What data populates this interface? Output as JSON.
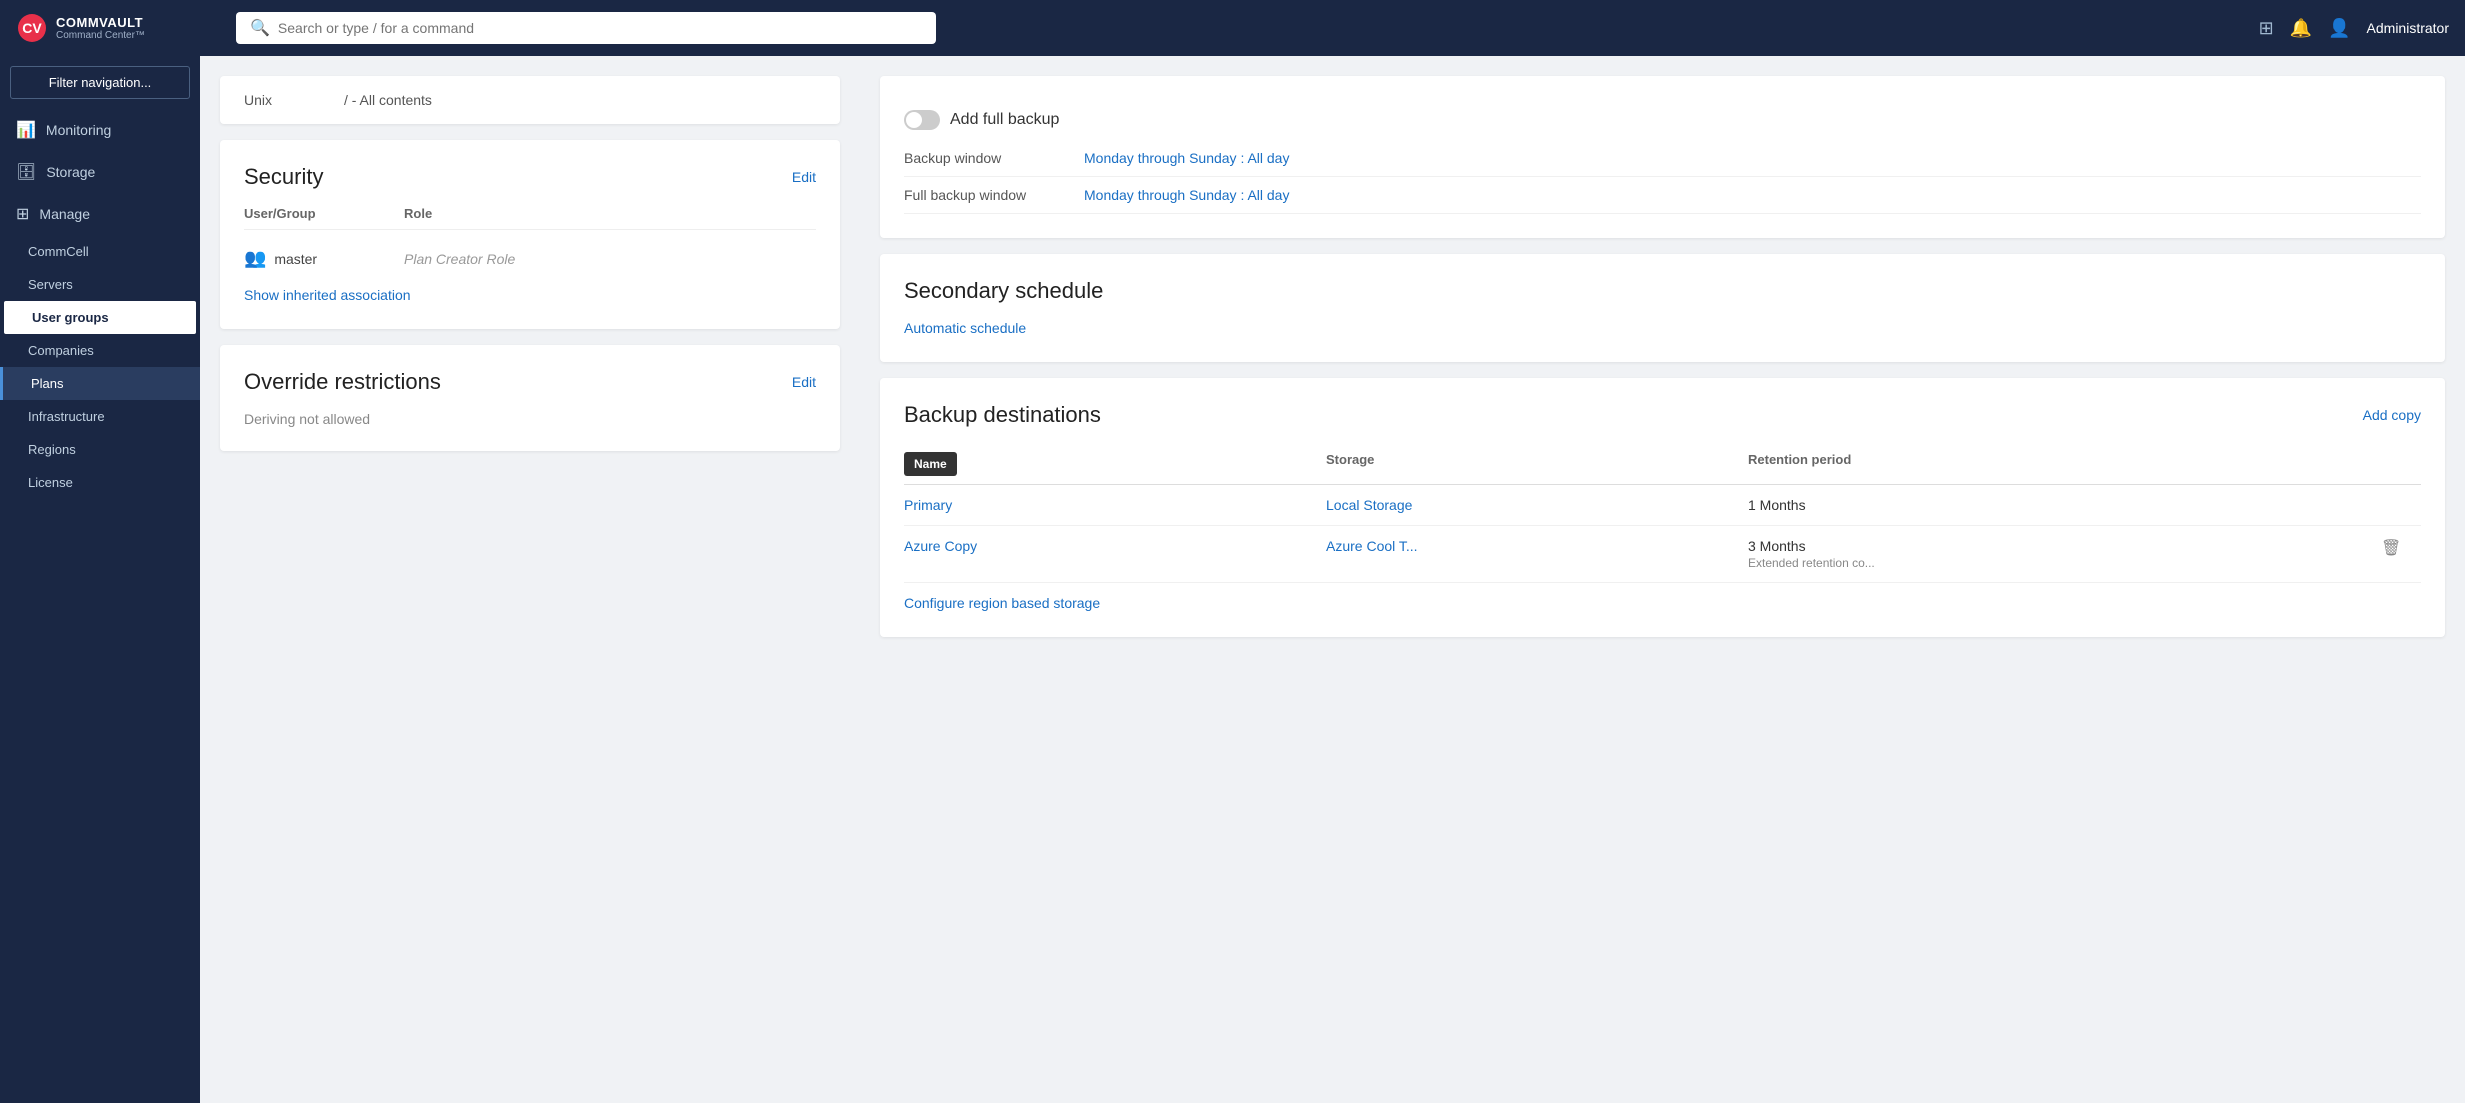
{
  "header": {
    "logo_line1": "COMMVAULT",
    "logo_line2": "Command Center™",
    "search_placeholder": "Search or type / for a command",
    "admin_label": "Administrator"
  },
  "sidebar": {
    "filter_placeholder": "Filter navigation...",
    "items": [
      {
        "id": "monitoring",
        "label": "Monitoring",
        "icon": "📊"
      },
      {
        "id": "storage",
        "label": "Storage",
        "icon": "🗄"
      },
      {
        "id": "manage",
        "label": "Manage",
        "icon": "⚙"
      }
    ],
    "sub_items": [
      {
        "id": "commcell",
        "label": "CommCell"
      },
      {
        "id": "servers",
        "label": "Servers"
      },
      {
        "id": "user-groups",
        "label": "User groups",
        "highlighted": true
      },
      {
        "id": "companies",
        "label": "Companies"
      },
      {
        "id": "plans",
        "label": "Plans",
        "active": true
      },
      {
        "id": "infrastructure",
        "label": "Infrastructure"
      },
      {
        "id": "regions",
        "label": "Regions"
      },
      {
        "id": "license",
        "label": "License"
      }
    ]
  },
  "unix_row": {
    "label": "Unix",
    "path": "/  -  All contents"
  },
  "security": {
    "title": "Security",
    "edit_label": "Edit",
    "col_user_group": "User/Group",
    "col_role": "Role",
    "row": {
      "user": "master",
      "role": "Plan Creator Role"
    },
    "show_inherited": "Show inherited association"
  },
  "override_restrictions": {
    "title": "Override restrictions",
    "edit_label": "Edit",
    "text": "Deriving not allowed"
  },
  "right_panel": {
    "toggle_label": "Add full backup",
    "backup_window_label": "Backup window",
    "backup_window_value": "Monday through Sunday : All day",
    "full_backup_window_label": "Full backup window",
    "full_backup_window_value": "Monday through Sunday : All day",
    "secondary_schedule_title": "Secondary schedule",
    "auto_schedule_label": "Automatic schedule",
    "backup_destinations_title": "Backup destinations",
    "add_copy_label": "Add copy",
    "table_headers": {
      "name": "Name",
      "storage": "Storage",
      "retention": "Retention period"
    },
    "tooltip_name": "Name",
    "destinations": [
      {
        "name": "Primary",
        "storage": "Local Storage",
        "retention": "1 Months",
        "retention_sub": ""
      },
      {
        "name": "Azure Copy",
        "storage": "Azure Cool T...",
        "retention": "3 Months",
        "retention_sub": "Extended retention co..."
      }
    ],
    "configure_link": "Configure region based storage"
  }
}
